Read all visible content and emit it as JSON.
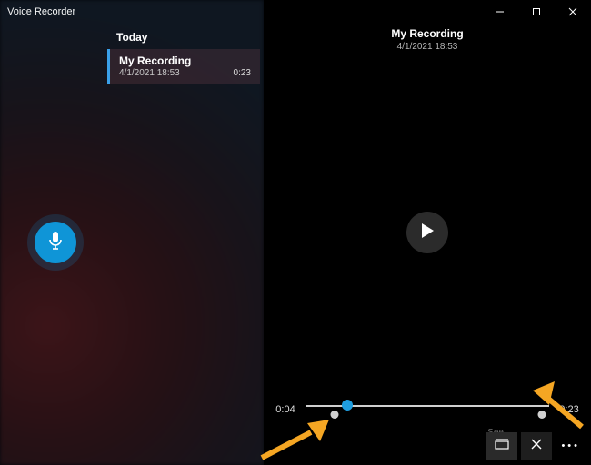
{
  "window": {
    "title": "Voice Recorder"
  },
  "colors": {
    "accent": "#0f95d7",
    "arrow": "#f5a623"
  },
  "sidebar": {
    "section_label": "Today",
    "items": [
      {
        "title": "My Recording",
        "timestamp": "4/1/2021 18:53",
        "duration": "0:23"
      }
    ]
  },
  "player": {
    "title": "My Recording",
    "timestamp": "4/1/2021 18:53",
    "current_time": "0:04",
    "total_time": "0:23",
    "progress_percent": 17,
    "markers_percent": [
      12,
      97
    ]
  },
  "footer": {
    "hint_label": "See"
  }
}
